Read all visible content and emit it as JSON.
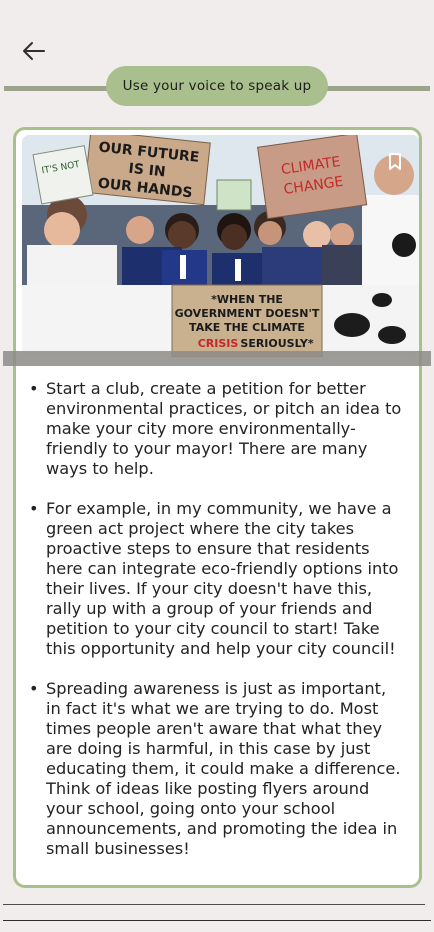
{
  "header": {
    "back_icon": "arrow-left-icon",
    "title": "Use your voice to speak up"
  },
  "card": {
    "bookmark_icon": "bookmark-icon",
    "photo": {
      "signs": [
        "OUR FUTURE IS IN OUR HANDS",
        "CLIMATE CHANGE",
        "IT'S NOT",
        "WHEN THE GOVERNMENT DOESN'T TAKE THE CLIMATE CRISIS SERIOUSLY"
      ]
    },
    "bullets": [
      "Start a club, create a petition for better environmental practices, or pitch an idea to make your city more environmentally-friendly to your mayor! There are many ways to help.",
      "For example, in my community, we have a green act project where the city takes proactive steps to ensure that residents here can integrate eco-friendly options into their lives. If your city doesn't have this, rally up with a group of your friends and petition to your city council to start! Take this opportunity and help your city council!",
      "Spreading awareness is just as important, in fact it's what we are trying to do. Most times people aren't aware that what they are doing is harmful, in this case by just educating them, it could make a difference. Think of ideas like posting flyers around your school, going onto your school announcements, and promoting the idea in small businesses!"
    ]
  },
  "colors": {
    "background": "#f1edec",
    "accent_green": "#a9c08e",
    "rule_gray": "#9ba48b",
    "card_bg": "#ffffff"
  }
}
